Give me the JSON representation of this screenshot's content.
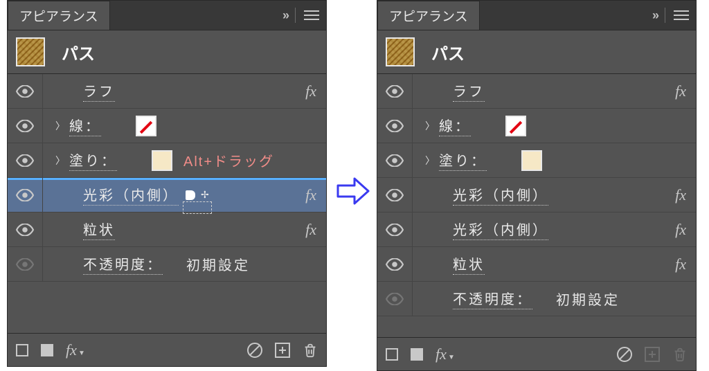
{
  "left": {
    "tab": "アピアランス",
    "title": "パス",
    "rows": [
      {
        "kind": "fx",
        "label": "ラフ"
      },
      {
        "kind": "stroke",
        "label": "線："
      },
      {
        "kind": "fill",
        "label": "塗り：",
        "hint": "Alt+ドラッグ"
      },
      {
        "kind": "fx",
        "label": "光彩（内側）",
        "selected": true,
        "insertAbove": true,
        "dragCursor": true
      },
      {
        "kind": "fx",
        "label": "粒状"
      },
      {
        "kind": "opacity",
        "label": "不透明度：",
        "value": "初期設定"
      }
    ]
  },
  "right": {
    "tab": "アピアランス",
    "title": "パス",
    "rows": [
      {
        "kind": "fx",
        "label": "ラフ"
      },
      {
        "kind": "stroke",
        "label": "線："
      },
      {
        "kind": "fill",
        "label": "塗り："
      },
      {
        "kind": "fx",
        "label": "光彩（内側）"
      },
      {
        "kind": "fx",
        "label": "光彩（内側）"
      },
      {
        "kind": "fx",
        "label": "粒状"
      },
      {
        "kind": "opacity",
        "label": "不透明度：",
        "value": "初期設定"
      }
    ]
  },
  "footer": {
    "fx": "fx"
  }
}
